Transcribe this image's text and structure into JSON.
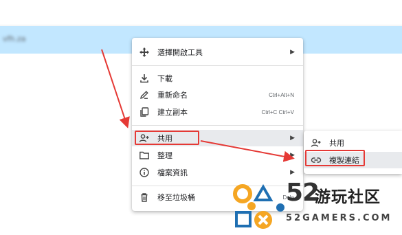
{
  "file_row": {
    "name": "vfh.za"
  },
  "context_menu": {
    "items": [
      {
        "label": "選擇開啟工具",
        "icon": "move-icon",
        "shortcut": "",
        "has_submenu": true
      },
      {
        "label": "下載",
        "icon": "download-icon",
        "shortcut": "",
        "has_submenu": false
      },
      {
        "label": "重新命名",
        "icon": "rename-pen-icon",
        "shortcut": "Ctrl+Alt+N",
        "has_submenu": false
      },
      {
        "label": "建立副本",
        "icon": "copy-icon",
        "shortcut": "Ctrl+C Ctrl+V",
        "has_submenu": false
      },
      {
        "label": "共用",
        "icon": "person-add-icon",
        "shortcut": "",
        "has_submenu": true,
        "highlighted": true
      },
      {
        "label": "整理",
        "icon": "folder-icon",
        "shortcut": "",
        "has_submenu": true
      },
      {
        "label": "檔案資訊",
        "icon": "info-icon",
        "shortcut": "",
        "has_submenu": true
      },
      {
        "label": "移至垃圾桶",
        "icon": "trash-icon",
        "shortcut": "Dele",
        "has_submenu": false
      }
    ]
  },
  "share_submenu": {
    "items": [
      {
        "label": "共用",
        "icon": "person-add-icon"
      },
      {
        "label": "複製連結",
        "icon": "link-icon",
        "highlighted": true
      }
    ]
  },
  "watermark": {
    "number": "52",
    "chinese": "游玩社区",
    "english": "52GAMERS.COM"
  },
  "colors": {
    "selected_row": "#c2e7ff",
    "annotation_red": "#e53935",
    "watermark_orange": "#f5a623",
    "watermark_blue": "#1f6fb2"
  }
}
